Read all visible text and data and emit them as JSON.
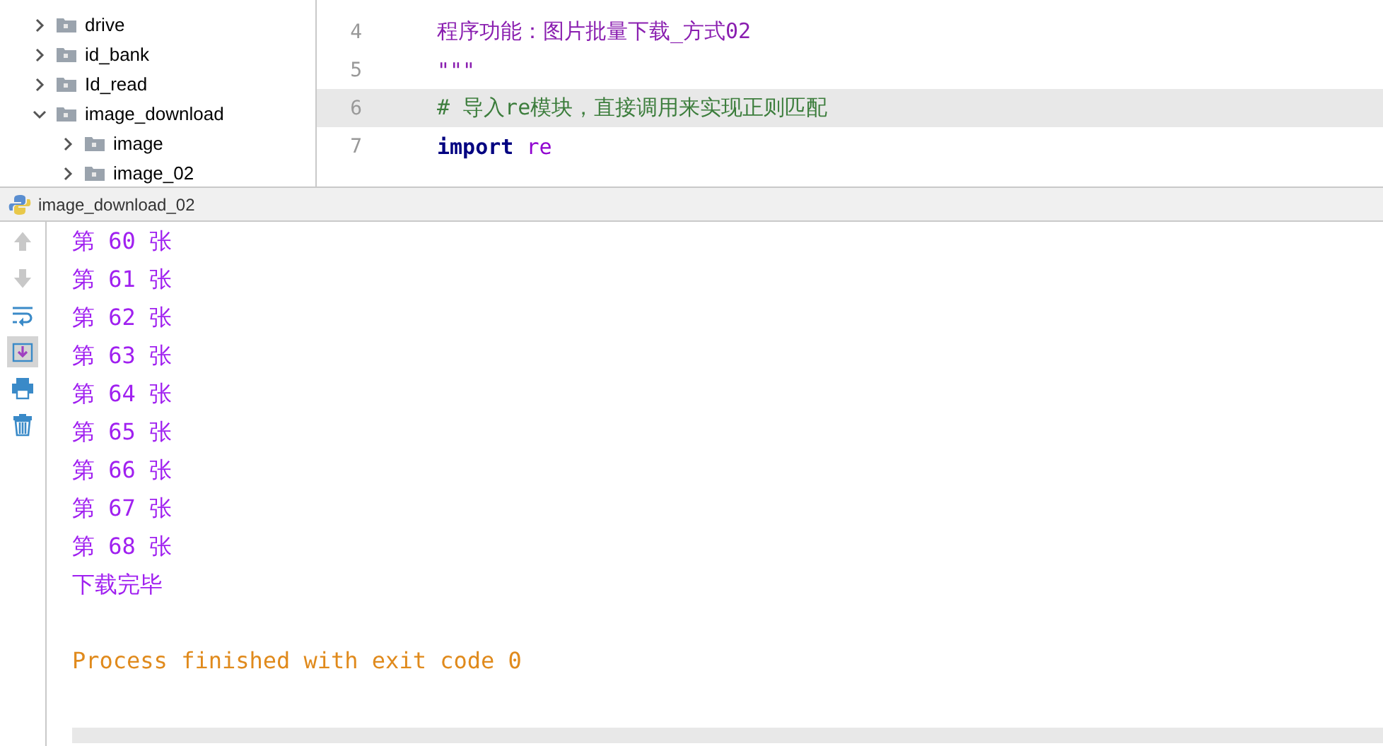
{
  "project_tree": {
    "items": [
      {
        "label": "drive",
        "expanded": false
      },
      {
        "label": "id_bank",
        "expanded": false
      },
      {
        "label": "Id_read",
        "expanded": false
      },
      {
        "label": "image_download",
        "expanded": true,
        "children": [
          {
            "label": "image",
            "expanded": false
          },
          {
            "label": "image_02",
            "expanded": false
          }
        ]
      }
    ]
  },
  "editor": {
    "lines": [
      {
        "number": "4",
        "text": "程序功能：图片批量下载_方式02",
        "kind": "docstring",
        "highlighted": false
      },
      {
        "number": "5",
        "text": "\"\"\"",
        "kind": "docstring",
        "highlighted": false
      },
      {
        "number": "6",
        "text": "#  导入re模块，直接调用来实现正则匹配",
        "kind": "comment",
        "highlighted": true
      },
      {
        "number": "7",
        "text": "import re",
        "kind": "import",
        "highlighted": false
      }
    ]
  },
  "run_panel": {
    "tab": {
      "label": "image_download_02"
    },
    "tools": [
      {
        "kind": "up",
        "disabled": true,
        "selected": false
      },
      {
        "kind": "down",
        "disabled": true,
        "selected": false
      },
      {
        "kind": "wrap",
        "disabled": false,
        "selected": false
      },
      {
        "kind": "scroll-end",
        "disabled": false,
        "selected": true
      },
      {
        "kind": "print",
        "disabled": false,
        "selected": false
      },
      {
        "kind": "trash",
        "disabled": false,
        "selected": false
      }
    ],
    "output": [
      {
        "text": "第 60 张",
        "kind": "stdout"
      },
      {
        "text": "第 61 张",
        "kind": "stdout"
      },
      {
        "text": "第 62 张",
        "kind": "stdout"
      },
      {
        "text": "第 63 张",
        "kind": "stdout"
      },
      {
        "text": "第 64 张",
        "kind": "stdout"
      },
      {
        "text": "第 65 张",
        "kind": "stdout"
      },
      {
        "text": "第 66 张",
        "kind": "stdout"
      },
      {
        "text": "第 67 张",
        "kind": "stdout"
      },
      {
        "text": "第 68 张",
        "kind": "stdout"
      },
      {
        "text": "下载完毕",
        "kind": "stdout"
      },
      {
        "text": "Process finished with exit code 0",
        "kind": "exit"
      }
    ]
  }
}
